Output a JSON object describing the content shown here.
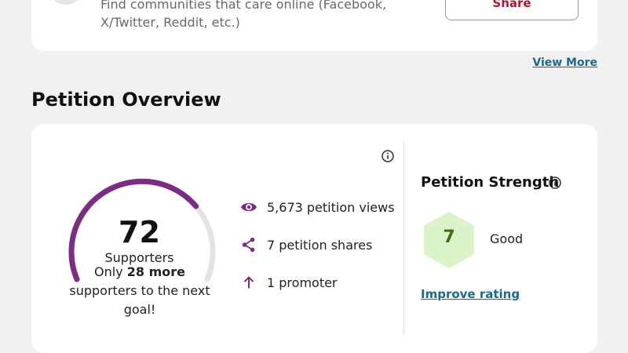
{
  "top_card": {
    "description": "Find communities that care online (Facebook, X/Twitter, Reddit, etc.)",
    "share_label": "Share"
  },
  "view_more_label": "View More",
  "overview": {
    "title": "Petition Overview",
    "supporters_count": "72",
    "supporters_label": "Supporters",
    "goal_prefix": "Only ",
    "goal_highlight": "28 more",
    "goal_suffix": " supporters to the next goal!",
    "progress_fraction": 0.72,
    "stats": [
      {
        "icon": "eye-icon",
        "text": "5,673 petition views"
      },
      {
        "icon": "share-icon",
        "text": "7 petition shares"
      },
      {
        "icon": "arrow-up-icon",
        "text": "1 promoter"
      }
    ]
  },
  "strength": {
    "title": "Petition Strength",
    "score": "7",
    "rating": "Good",
    "improve_label": "Improve rating"
  },
  "colors": {
    "accent_purple": "#7b2c83",
    "track_gray": "#e4e4e4",
    "share_red": "#b2182b",
    "link_teal": "#1b6a8a",
    "hex_fill": "#dcf2c8"
  }
}
